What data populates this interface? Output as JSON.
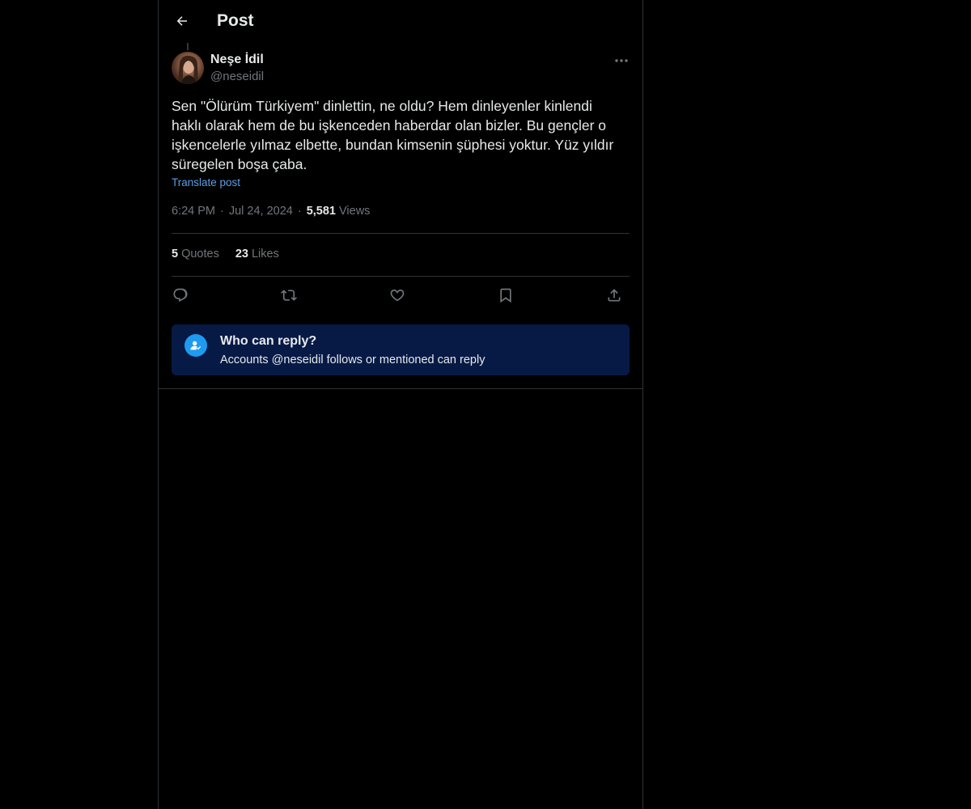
{
  "header": {
    "title": "Post",
    "back_icon": "arrow-left-icon"
  },
  "post": {
    "author_name": "Neşe İdil",
    "author_handle": "@neseidil",
    "text": "Sen \"Ölürüm Türkiyem\" dinlettin, ne oldu? Hem dinleyenler kinlendi\nhaklı olarak hem de bu işkenceden haberdar olan bizler. Bu gençler o\nişkencelerle yılmaz elbette, bundan kimsenin şüphesi yoktur. Yüz yıldır\nsüregelen boşa çaba.",
    "translate_label": "Translate post",
    "time": "6:24 PM",
    "separator": "·",
    "date": "Jul 24, 2024",
    "views_count": "5,581",
    "views_label": "Views",
    "more_icon": "more-horizontal-icon"
  },
  "stats": {
    "quotes_count": "5",
    "quotes_label": "Quotes",
    "likes_count": "23",
    "likes_label": "Likes"
  },
  "actions": [
    {
      "name": "reply",
      "icon": "reply-icon"
    },
    {
      "name": "repost",
      "icon": "repost-icon"
    },
    {
      "name": "like",
      "icon": "heart-icon"
    },
    {
      "name": "bookmark",
      "icon": "bookmark-icon"
    },
    {
      "name": "share",
      "icon": "share-icon"
    }
  ],
  "reply_restriction": {
    "title": "Who can reply?",
    "subtitle": "Accounts @neseidil follows or mentioned can reply",
    "icon": "user-check-icon"
  },
  "colors": {
    "background": "#000000",
    "text": "#e7e9ea",
    "muted": "#71767b",
    "link": "#5c9ee6",
    "accent": "#1d9bf0",
    "reply_box": "#071a46",
    "border": "#2f3336"
  }
}
